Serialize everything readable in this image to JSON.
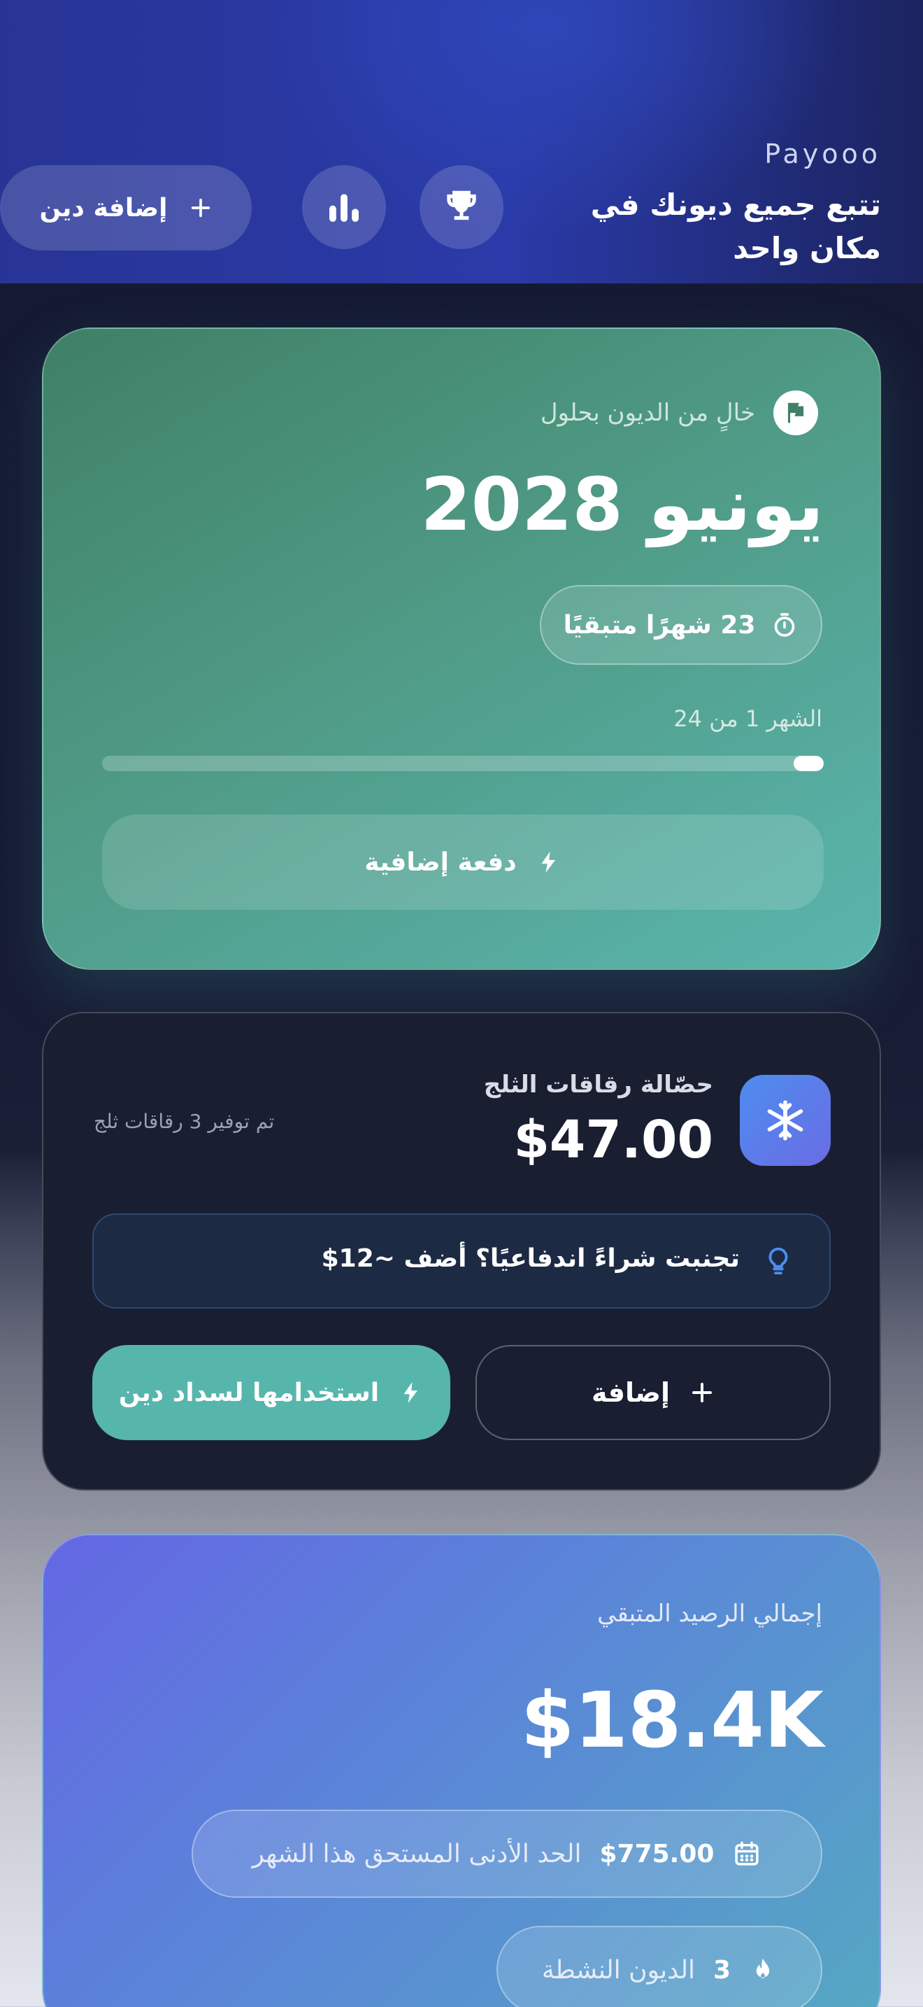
{
  "header": {
    "brand": "Payooo",
    "tagline": "تتبع جميع ديونك في مكان واحد",
    "add_debt_label": "إضافة دين",
    "icons": [
      "trophy-icon",
      "bar-chart-icon",
      "plus-icon"
    ]
  },
  "debt_free_card": {
    "label": "خالٍ من الديون بحلول",
    "date": "يونيو 2028",
    "months_left": "23 شهرًا متبقيًا",
    "progress_label": "الشهر 1 من 24",
    "progress_fraction": 0.0417,
    "extra_payment_label": "دفعة إضافية",
    "icons": [
      "flag-icon",
      "timer-icon",
      "lightning-icon"
    ]
  },
  "snowflake_card": {
    "title": "حصّالة رقاقات الثلج",
    "amount": "$47.00",
    "saved": "تم توفير 3 رقاقات ثلج",
    "tip": "تجنبت شراءً اندفاعيًا؟ أضف ~12$",
    "use_label": "استخدامها لسداد دين",
    "add_label": "إضافة",
    "icons": [
      "snowflake-icon",
      "lightbulb-icon",
      "lightning-icon",
      "plus-icon"
    ]
  },
  "balance_card": {
    "label": "إجمالي الرصيد المتبقي",
    "amount": "$18.4K",
    "min_due_amount": "$775.00",
    "min_due_label": "الحد الأدنى المستحق هذا الشهر",
    "active_count": "3",
    "active_label": "الديون النشطة",
    "icons": [
      "calendar-icon",
      "flame-icon"
    ]
  },
  "colors": {
    "header_blue": "#2a3aa8",
    "green_card": "#4f9a85",
    "teal_button": "#56b6ac",
    "snow_icon": "#4d8df0",
    "balance_card": "#5a86d8"
  }
}
